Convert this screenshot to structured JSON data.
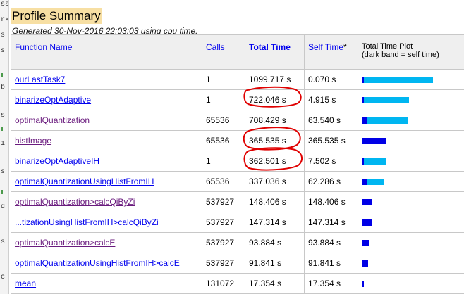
{
  "side_panel": {
    "lines": [
      "ss",
      "rk",
      "s",
      "s",
      "b",
      "s",
      "i",
      "s",
      "d",
      "s",
      "c"
    ]
  },
  "report": {
    "title": "Profile Summary",
    "generated": "Generated 30-Nov-2016 22:03:03 using cpu time."
  },
  "table": {
    "headers": {
      "function_name": "Function Name",
      "calls": "Calls",
      "total_time": "Total Time",
      "self_time": "Self Time",
      "self_time_marker": "*",
      "plot_title": "Total Time Plot",
      "plot_subtitle": "(dark band = self time)"
    },
    "rows": [
      {
        "name": "ourLastTask7",
        "calls": "1",
        "total": "1099.717 s",
        "self": "0.070 s",
        "visited": false
      },
      {
        "name": "binarizeOptAdaptive",
        "calls": "1",
        "total": "722.046 s",
        "self": "4.915 s",
        "visited": false
      },
      {
        "name": "optimalQuantization",
        "calls": "65536",
        "total": "708.429 s",
        "self": "63.540 s",
        "visited": true
      },
      {
        "name": "histImage",
        "calls": "65536",
        "total": "365.535 s",
        "self": "365.535 s",
        "visited": true
      },
      {
        "name": "binarizeOptAdaptiveIH",
        "calls": "1",
        "total": "362.501 s",
        "self": "7.502 s",
        "visited": false
      },
      {
        "name": "optimalQuantizationUsingHistFromIH",
        "calls": "65536",
        "total": "337.036 s",
        "self": "62.286 s",
        "visited": false
      },
      {
        "name": "optimalQuantization>calcQiByZi",
        "calls": "537927",
        "total": "148.406 s",
        "self": "148.406 s",
        "visited": true
      },
      {
        "name": "...tizationUsingHistFromIH>calcQiByZi",
        "calls": "537927",
        "total": "147.314 s",
        "self": "147.314 s",
        "visited": false
      },
      {
        "name": "optimalQuantization>calcE",
        "calls": "537927",
        "total": "93.884 s",
        "self": "93.884 s",
        "visited": true
      },
      {
        "name": "optimalQuantizationUsingHistFromIH>calcE",
        "calls": "537927",
        "total": "91.841 s",
        "self": "91.841 s",
        "visited": false
      },
      {
        "name": "mean",
        "calls": "131072",
        "total": "17.354 s",
        "self": "17.354 s",
        "visited": false
      }
    ],
    "plot_scale_max_seconds": 1099.717,
    "colors": {
      "total_bar": "#00b6f1",
      "self_bar": "#0000e6",
      "header_bg": "#efefef",
      "title_bg": "#f7dfa3",
      "annotation": "#e00000"
    }
  },
  "annotations": {
    "circled_values": [
      "722.046 s",
      "365.535 s",
      "362.501 s"
    ]
  }
}
